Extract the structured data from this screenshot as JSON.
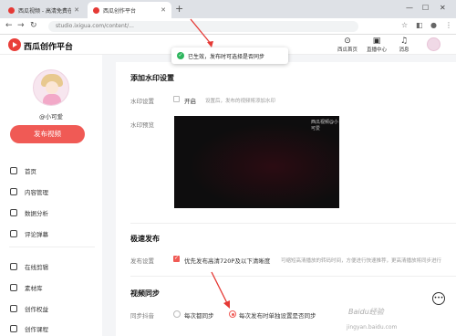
{
  "browser": {
    "tabs": [
      {
        "title": "西瓜视频 - 高清免费在线视频"
      },
      {
        "title": "西瓜创作平台"
      }
    ],
    "new_tab": "+",
    "url": "studio.ixigua.com/content/..."
  },
  "header": {
    "logo": "西瓜创作平台",
    "icons": [
      {
        "label": "西瓜首页",
        "icon": "home-icon"
      },
      {
        "label": "直播中心",
        "icon": "live-icon"
      },
      {
        "label": "消息",
        "icon": "bell-icon"
      }
    ]
  },
  "toast": {
    "text": "已生效，发布时可选择是否同步"
  },
  "sidebar": {
    "username": "@小可爱",
    "publish_label": "发布视频",
    "items": [
      {
        "label": "首页"
      },
      {
        "label": "内容管理"
      },
      {
        "label": "数据分析"
      },
      {
        "label": "评论弹幕"
      },
      {
        "label": "在线剪辑"
      },
      {
        "label": "素材库"
      },
      {
        "label": "创作权益"
      },
      {
        "label": "创作课程"
      }
    ]
  },
  "main": {
    "watermark_section": {
      "title": "添加水印设置",
      "label": "水印设置",
      "checkbox_text": "开启",
      "hint": "设置后，发布的视频将添加水印",
      "preview_label": "水印预览",
      "preview_watermark": "西瓜视频@小可爱"
    },
    "fast_publish": {
      "title": "极速发布",
      "label": "发布设置",
      "option": "优先发布高清720P及以下清晰度",
      "hint": "可缩短高清播放的转码时间，方便进行快速推荐，更高清播放将同步进行"
    },
    "sync": {
      "title": "视频同步",
      "label": "同步抖音",
      "options": [
        "每次都同步",
        "每次发布时单独设置是否同步"
      ],
      "selected": 1
    }
  },
  "page_watermark": {
    "brand": "Baidu经验",
    "site": "jingyan.baidu.com"
  }
}
